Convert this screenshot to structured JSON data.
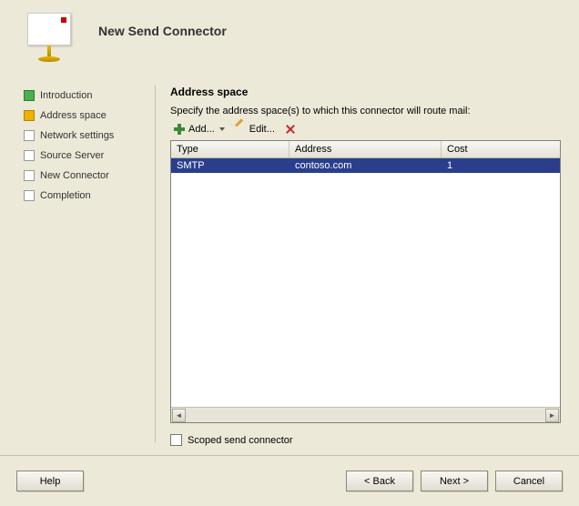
{
  "wizard": {
    "title": "New Send Connector",
    "steps": [
      {
        "label": "Introduction",
        "state": "done"
      },
      {
        "label": "Address space",
        "state": "current"
      },
      {
        "label": "Network settings",
        "state": "pending"
      },
      {
        "label": "Source Server",
        "state": "pending"
      },
      {
        "label": "New Connector",
        "state": "pending"
      },
      {
        "label": "Completion",
        "state": "pending"
      }
    ]
  },
  "page": {
    "heading": "Address space",
    "description": "Specify the address space(s) to which this connector will route mail:"
  },
  "toolbar": {
    "add_label": "Add...",
    "edit_label": "Edit...",
    "delete_tooltip": "Remove"
  },
  "table": {
    "columns": {
      "type": "Type",
      "address": "Address",
      "cost": "Cost"
    },
    "rows": [
      {
        "type": "SMTP",
        "address": "contoso.com",
        "cost": "1"
      }
    ]
  },
  "options": {
    "scoped_label": "Scoped send connector",
    "scoped_checked": false
  },
  "buttons": {
    "help": "Help",
    "back": "< Back",
    "next": "Next >",
    "cancel": "Cancel"
  }
}
